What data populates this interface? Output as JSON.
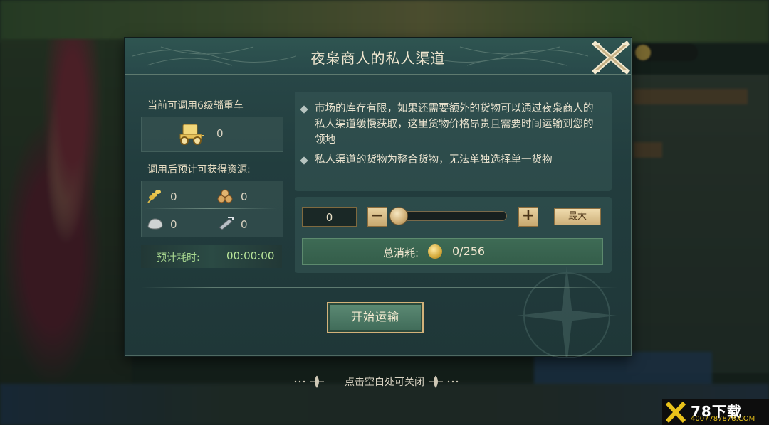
{
  "dialog": {
    "title": "夜枭商人的私人渠道",
    "close_label": "X",
    "wagon_label": "当前可调用6级辎重车",
    "wagon_count": "0",
    "resources_label": "调用后预计可获得资源:",
    "resources": [
      {
        "icon": "wheat-icon",
        "value": "0"
      },
      {
        "icon": "wood-logs-icon",
        "value": "0"
      },
      {
        "icon": "stone-icon",
        "value": "0"
      },
      {
        "icon": "iron-icon",
        "value": "0"
      }
    ],
    "eta_label": "预计耗时:",
    "eta_value": "00:00:00",
    "info": [
      "市场的库存有限，如果还需要额外的货物可以通过夜枭商人的私人渠道缓慢获取，这里货物价格昂贵且需要时间运输到您的领地",
      "私人渠道的货物为整合货物，无法单独选择单一货物"
    ],
    "quantity": "0",
    "slider_fraction": 0,
    "minus_label": "−",
    "plus_label": "+",
    "max_label": "最大",
    "cost_label": "总消耗:",
    "cost_value": "0/256",
    "start_label": "开始运输"
  },
  "close_hint": "点击空白处可关闭",
  "watermark": {
    "brand": "78下载",
    "site": "4007787878.COM"
  },
  "colors": {
    "accent_gold": "#d3b27a",
    "eta_green": "#b7e398",
    "panel": "#223d3e"
  }
}
